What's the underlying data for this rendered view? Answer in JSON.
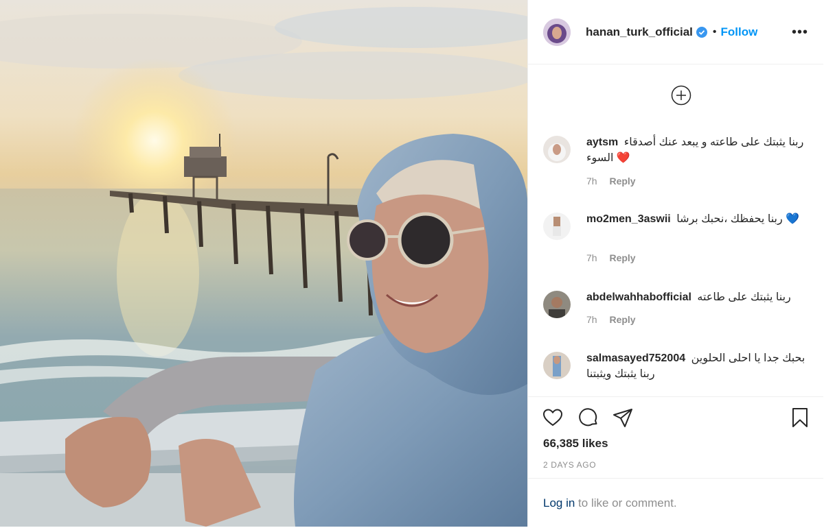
{
  "post": {
    "username": "hanan_turk_official",
    "separator": "•",
    "follow_label": "Follow",
    "more_label": "•••",
    "likes": "66,385 likes",
    "date": "2 DAYS AGO",
    "login_link": "Log in",
    "login_rest": " to like or comment."
  },
  "comments": [
    {
      "user": "aytsm",
      "text": "ربنا يثبتك على طاعته و يبعد عنك أصدقاء السوء",
      "emoji": "❤️",
      "time": "7h",
      "reply": "Reply"
    },
    {
      "user": "mo2men_3aswii",
      "text": "ربنا يحفظك ،نحبك برشا",
      "emoji": "💙",
      "time": "7h",
      "reply": "Reply"
    },
    {
      "user": "abdelwahhabofficial",
      "text": "ربنا يثبتك على طاعته",
      "emoji": "",
      "time": "7h",
      "reply": "Reply"
    },
    {
      "user": "salmasayed752004",
      "text": "بحبك جدا يا احلى الحلوين ربنا يثبتك ويثبتنا",
      "emoji": "",
      "time": "",
      "reply": ""
    }
  ],
  "colors": {
    "accent": "#0095f6",
    "link": "#00376b",
    "muted": "#8e8e8e",
    "text": "#262626"
  },
  "icons": [
    "verified-badge-icon",
    "more-options-icon",
    "load-more-comments-icon",
    "heart-icon",
    "comment-icon",
    "share-icon",
    "bookmark-icon"
  ]
}
